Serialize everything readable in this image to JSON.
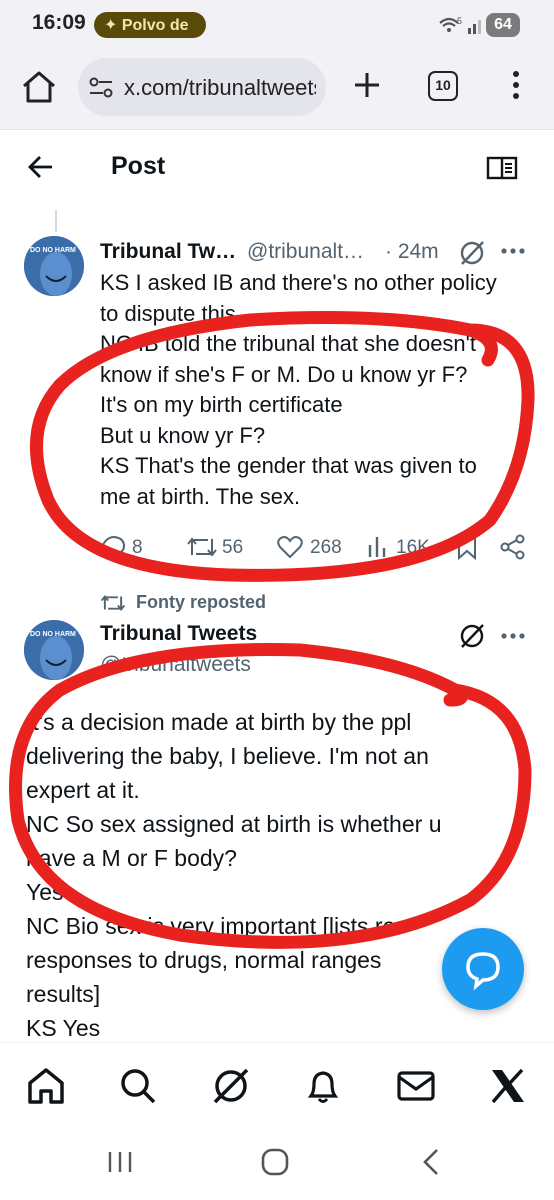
{
  "status": {
    "time": "16:09",
    "notification": "Polvo de",
    "battery": "64",
    "signal_badge": "5"
  },
  "browser": {
    "url": "x.com/tribunaltweets",
    "tab_count": "10"
  },
  "header": {
    "title": "Post"
  },
  "tweet1": {
    "avatar_text": "DO NO HARM",
    "name": "Tribunal Tw…",
    "handle": "@tribunalt…",
    "time": "· 24m",
    "lines": [
      "KS  I asked IB and there's no other policy",
      "to dispute this",
      "NC  IB told the tribunal that she doesn't",
      "know if she's F or M. Do u know yr F?",
      "It's on my birth certificate",
      "But u know yr F?",
      "KS That's the gender that was given to",
      "me at birth. The sex."
    ],
    "replies": "8",
    "retweets": "56",
    "likes": "268",
    "views": "16K"
  },
  "repost": {
    "label": "Fonty reposted"
  },
  "tweet2": {
    "avatar_text": "DO NO HARM",
    "name": "Tribunal Tweets",
    "handle": "@tribunaltweets",
    "lines": [
      "It's a decision made at birth by the ppl",
      "delivering the baby, I believe. I'm not an",
      "expert at it.",
      "NC  So sex assigned at birth is whether u",
      "have a M or F body?",
      "Yes",
      "NC  Bio sex is very important [lists re",
      "responses to drugs, normal ranges",
      "results]",
      "KS  Yes"
    ]
  },
  "colors": {
    "accent": "#1d9bf0",
    "annotation": "#e8231f",
    "text": "#0f1419",
    "muted": "#536471"
  },
  "icons": [
    "home-icon",
    "search-icon",
    "grok-icon",
    "bell-icon",
    "mail-icon",
    "x-logo-icon"
  ]
}
